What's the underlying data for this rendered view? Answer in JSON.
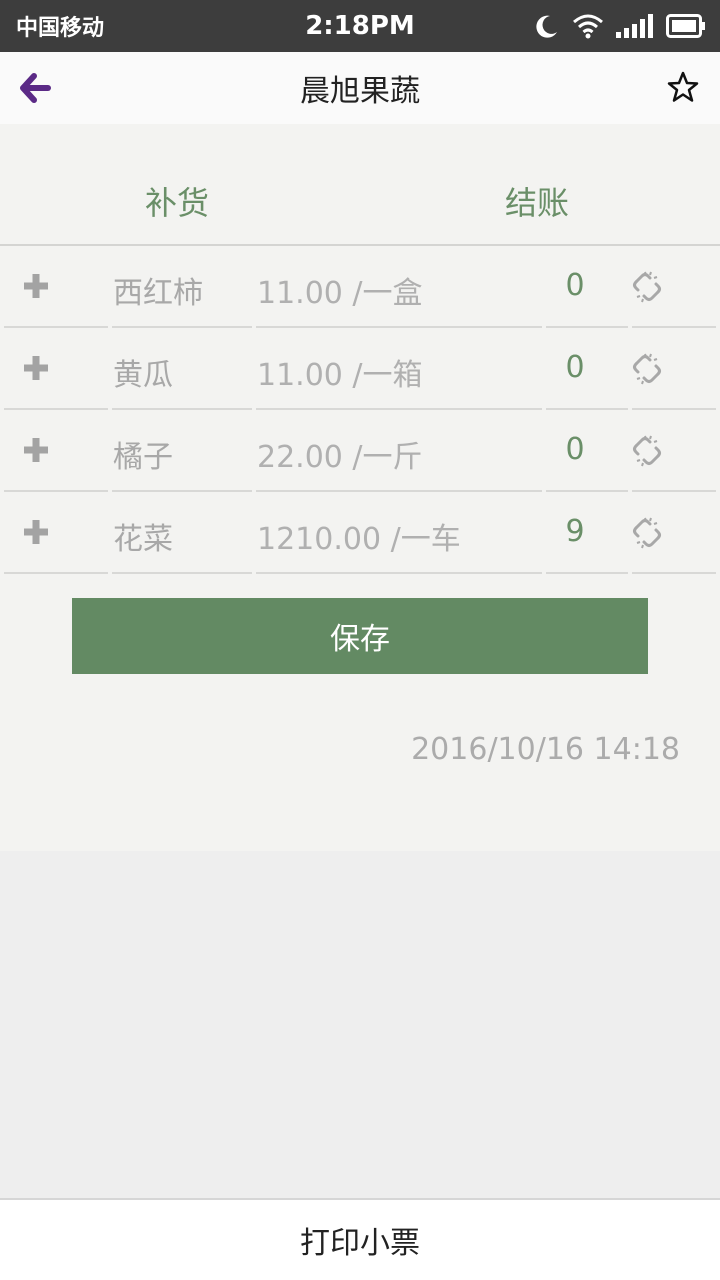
{
  "status_bar": {
    "carrier": "中国移动",
    "time": "2:18PM"
  },
  "navbar": {
    "title": "晨旭果蔬",
    "back_icon": "arrow-left-icon",
    "star_icon": "star-outline-icon"
  },
  "tabs": {
    "restock": "补货",
    "checkout": "结账"
  },
  "items": [
    {
      "name": "西红柿",
      "price": "11.00 /一盒",
      "qty": "0"
    },
    {
      "name": "黄瓜",
      "price": "11.00 /一箱",
      "qty": "0"
    },
    {
      "name": "橘子",
      "price": "22.00 /一斤",
      "qty": "0"
    },
    {
      "name": "花菜",
      "price": "1210.00 /一车",
      "qty": "9"
    }
  ],
  "save_label": "保存",
  "timestamp": "2016/10/16 14:18",
  "print_label": "打印小票",
  "colors": {
    "accent_green": "#638a63",
    "tab_green": "#6a8f68",
    "back_purple": "#5b2a86",
    "status_bar": "#3d3d3d"
  }
}
